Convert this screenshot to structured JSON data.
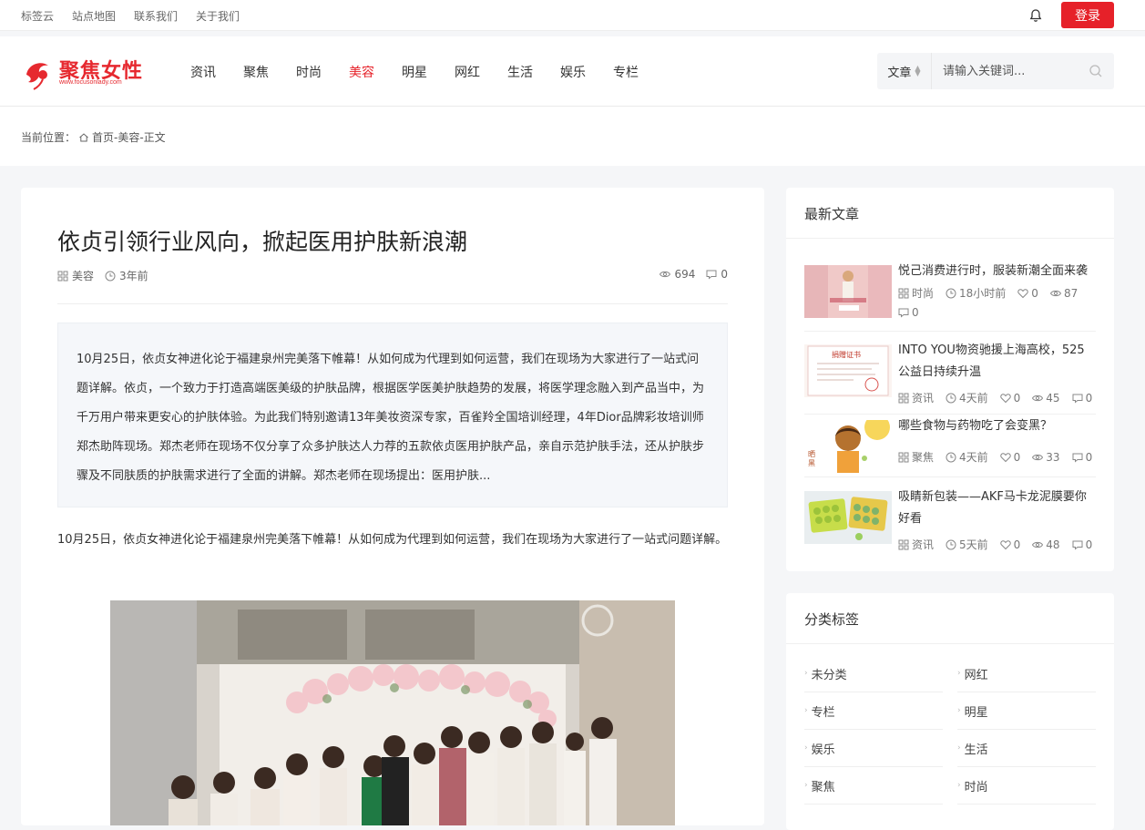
{
  "topbar": {
    "links": [
      "标签云",
      "站点地图",
      "联系我们",
      "关于我们"
    ],
    "login_label": "登录"
  },
  "header": {
    "logo_text": "聚焦女性",
    "logo_url": "www.focusonlady.com",
    "nav": [
      "资讯",
      "聚焦",
      "时尚",
      "美容",
      "明星",
      "网红",
      "生活",
      "娱乐",
      "专栏"
    ],
    "active_nav": "美容",
    "search": {
      "type": "文章",
      "placeholder": "请输入关键词..."
    }
  },
  "breadcrumb": {
    "prefix": "当前位置：",
    "path": "首页-美容-正文"
  },
  "article": {
    "title": "依贞引领行业风向，掀起医用护肤新浪潮",
    "category": "美容",
    "time": "3年前",
    "views": "694",
    "comments": "0",
    "summary": "10月25日，依贞女神进化论于福建泉州完美落下帷幕！从如何成为代理到如何运营，我们在现场为大家进行了一站式问题详解。依贞，一个致力于打造高端医美级的护肤品牌，根据医学医美护肤趋势的发展，将医学理念融入到产品当中，为千万用户带来更安心的护肤体验。为此我们特别邀请13年美妆资深专家，百雀羚全国培训经理，4年Dior品牌彩妆培训师郑杰助阵现场。郑杰老师在现场不仅分享了众多护肤达人力荐的五款依贞医用护肤产品，亲自示范护肤手法，还从护肤步骤及不同肤质的护肤需求进行了全面的讲解。郑杰老师在现场提出：医用护肤...",
    "paragraph": "10月25日，依贞女神进化论于福建泉州完美落下帷幕！从如何成为代理到如何运营，我们在现场为大家进行了一站式问题详解。"
  },
  "sidebar": {
    "latest_title": "最新文章",
    "posts": [
      {
        "title": "悦己消费进行时，服装新潮全面来袭",
        "category": "时尚",
        "time": "18小时前",
        "likes": "0",
        "views": "87",
        "comments": "0"
      },
      {
        "title": "INTO YOU物资驰援上海高校，525公益日持续升温",
        "category": "资讯",
        "time": "4天前",
        "likes": "0",
        "views": "45",
        "comments": "0"
      },
      {
        "title": "哪些食物与药物吃了会变黑？",
        "category": "聚焦",
        "time": "4天前",
        "likes": "0",
        "views": "33",
        "comments": "0"
      },
      {
        "title": "吸睛新包装——AKF马卡龙泥膜要你好看",
        "category": "资讯",
        "time": "5天前",
        "likes": "0",
        "views": "48",
        "comments": "0"
      }
    ],
    "tags_title": "分类标签",
    "tags": [
      "未分类",
      "网红",
      "专栏",
      "明星",
      "娱乐",
      "生活",
      "聚焦",
      "时尚"
    ]
  },
  "colors": {
    "accent": "#e62129",
    "page_bg": "#f5f6f8"
  }
}
